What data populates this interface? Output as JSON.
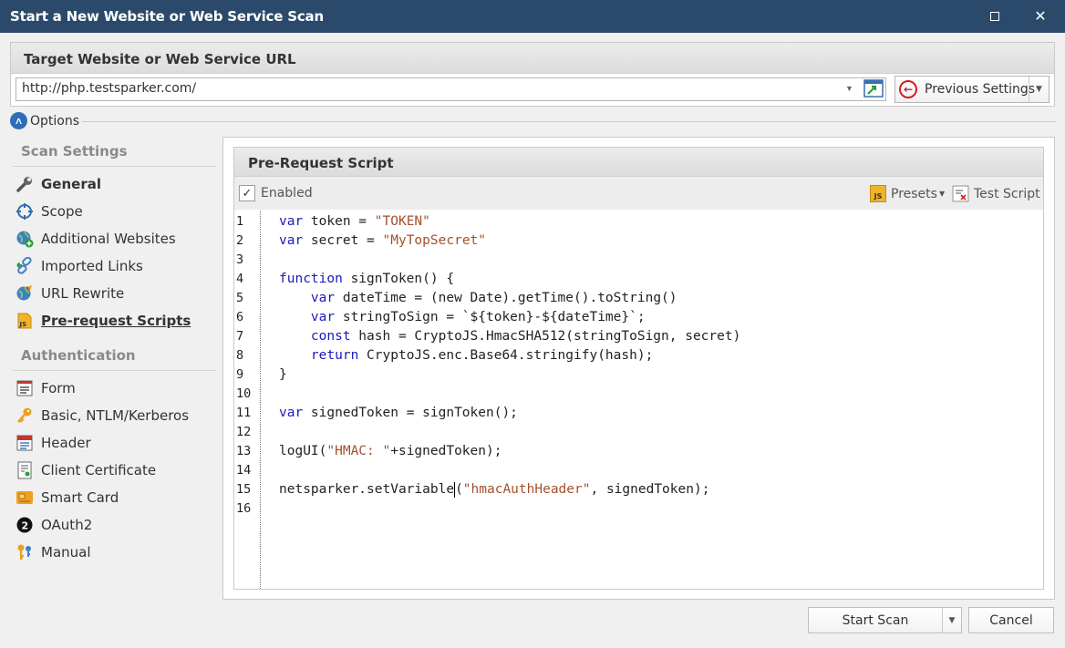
{
  "window": {
    "title": "Start a New Website or Web Service Scan"
  },
  "target": {
    "header": "Target Website or Web Service URL",
    "url": "http://php.testsparker.com/",
    "previous_settings_label": "Previous Settings"
  },
  "options": {
    "label": "Options"
  },
  "sidebar": {
    "scan_settings_title": "Scan Settings",
    "scan_items": [
      {
        "label": "General",
        "icon": "wrench-icon"
      },
      {
        "label": "Scope",
        "icon": "crosshair-icon"
      },
      {
        "label": "Additional Websites",
        "icon": "globe-add-icon"
      },
      {
        "label": "Imported Links",
        "icon": "link-import-icon"
      },
      {
        "label": "URL Rewrite",
        "icon": "globe-edit-icon"
      },
      {
        "label": "Pre-request Scripts",
        "icon": "js-file-icon"
      }
    ],
    "authentication_title": "Authentication",
    "auth_items": [
      {
        "label": "Form",
        "icon": "form-icon"
      },
      {
        "label": "Basic, NTLM/Kerberos",
        "icon": "key-icon"
      },
      {
        "label": "Header",
        "icon": "header-icon"
      },
      {
        "label": "Client Certificate",
        "icon": "certificate-icon"
      },
      {
        "label": "Smart Card",
        "icon": "smart-card-icon"
      },
      {
        "label": "OAuth2",
        "icon": "oauth2-icon"
      },
      {
        "label": "Manual",
        "icon": "keys-icon"
      }
    ]
  },
  "script": {
    "header": "Pre-Request Script",
    "enabled_label": "Enabled",
    "presets_label": "Presets",
    "test_script_label": "Test Script",
    "lines": [
      "var token = \"TOKEN\"",
      "var secret = \"MyTopSecret\"",
      "",
      "function signToken() {",
      "    var dateTime = (new Date).getTime().toString()",
      "    var stringToSign = `${token}-${dateTime}`;",
      "    const hash = CryptoJS.HmacSHA512(stringToSign, secret)",
      "    return CryptoJS.enc.Base64.stringify(hash);",
      "}",
      "",
      "var signedToken = signToken();",
      "",
      "logUI(\"HMAC: \"+signedToken);",
      "",
      "netsparker.setVariable(\"hmacAuthHeader\", signedToken);",
      ""
    ]
  },
  "buttons": {
    "start_scan": "Start Scan",
    "cancel": "Cancel"
  },
  "colors": {
    "titlebar": "#2b4a6b",
    "keyword": "#1a1ab8",
    "string": "#a3512b"
  }
}
